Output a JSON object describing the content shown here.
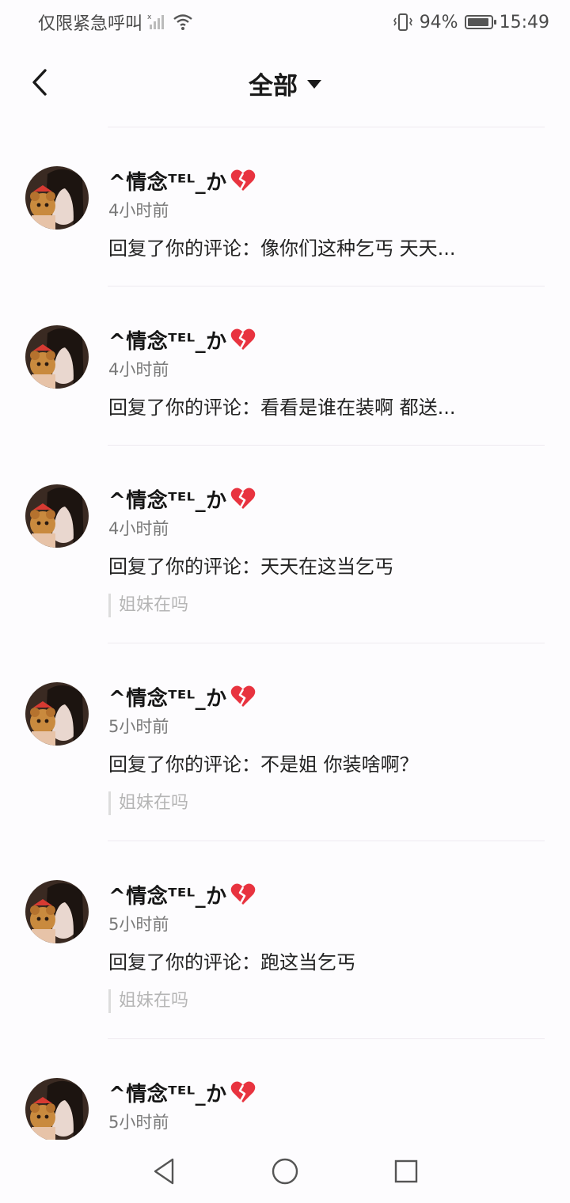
{
  "status_bar": {
    "carrier_text": "仅限紧急呼叫",
    "battery_percent": "94%",
    "battery_level": 0.94,
    "time": "15:49"
  },
  "header": {
    "title": "全部",
    "back_icon": "chevron-left-icon",
    "dropdown_icon": "caret-down-icon"
  },
  "notifications": [
    {
      "user": "^情念ᵀᴱᴸ_か",
      "time": "4小时前",
      "content": "回复了你的评论：像你们这种乞丐 天天...",
      "quote": ""
    },
    {
      "user": "^情念ᵀᴱᴸ_か",
      "time": "4小时前",
      "content": "回复了你的评论：看看是谁在装啊 都送...",
      "quote": ""
    },
    {
      "user": "^情念ᵀᴱᴸ_か",
      "time": "4小时前",
      "content": "回复了你的评论：天天在这当乞丐",
      "quote": "姐妹在吗"
    },
    {
      "user": "^情念ᵀᴱᴸ_か",
      "time": "5小时前",
      "content": "回复了你的评论：不是姐 你装啥啊？",
      "quote": "姐妹在吗"
    },
    {
      "user": "^情念ᵀᴱᴸ_か",
      "time": "5小时前",
      "content": "回复了你的评论：跑这当乞丐",
      "quote": "姐妹在吗"
    },
    {
      "user": "^情念ᵀᴱᴸ_か",
      "time": "5小时前",
      "content": "",
      "quote": ""
    }
  ],
  "colors": {
    "background": "#fdfcfe",
    "broken_heart": "#e8333f",
    "divider": "#eeeaf0"
  }
}
